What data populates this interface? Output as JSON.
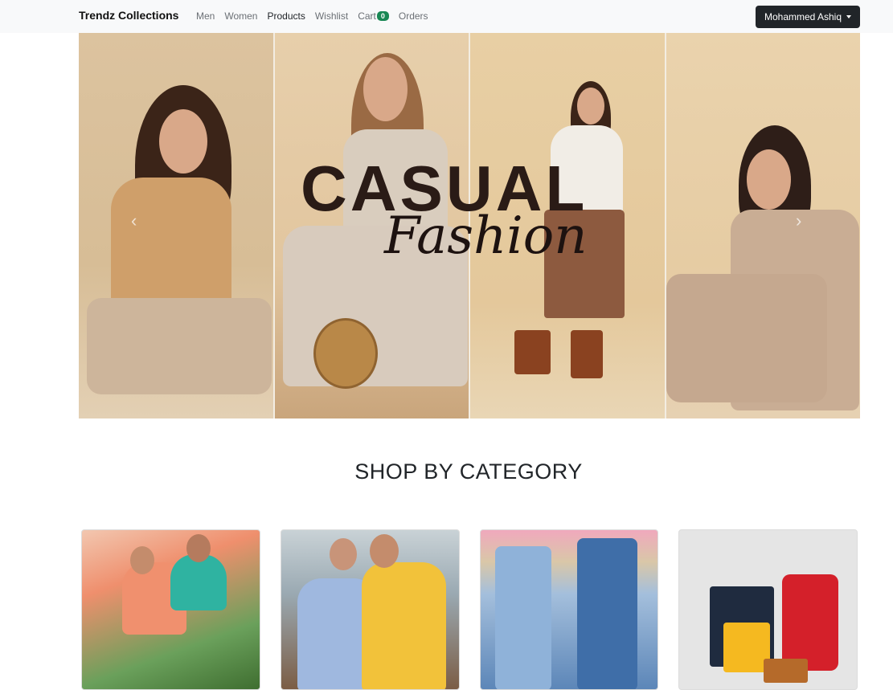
{
  "navbar": {
    "brand": "Trendz Collections",
    "links": [
      {
        "label": "Men"
      },
      {
        "label": "Women"
      },
      {
        "label": "Products"
      },
      {
        "label": "Wishlist"
      },
      {
        "label": "Cart"
      },
      {
        "label": "Orders"
      }
    ],
    "cart_count": "0",
    "user_name": "Mohammed Ashiq",
    "colors": {
      "background": "#f8f9fa",
      "badge": "#198754",
      "user_button": "#212529"
    }
  },
  "hero": {
    "title": "CASUAL",
    "subtitle": "Fashion",
    "prev_icon": "chevron-left-icon",
    "next_icon": "chevron-right-icon"
  },
  "section": {
    "title": "SHOP BY CATEGORY"
  },
  "categories": [
    {
      "image": "men-casual-photo"
    },
    {
      "image": "men-shirts-photo"
    },
    {
      "image": "jeans-photo"
    },
    {
      "image": "bags-photo"
    }
  ]
}
